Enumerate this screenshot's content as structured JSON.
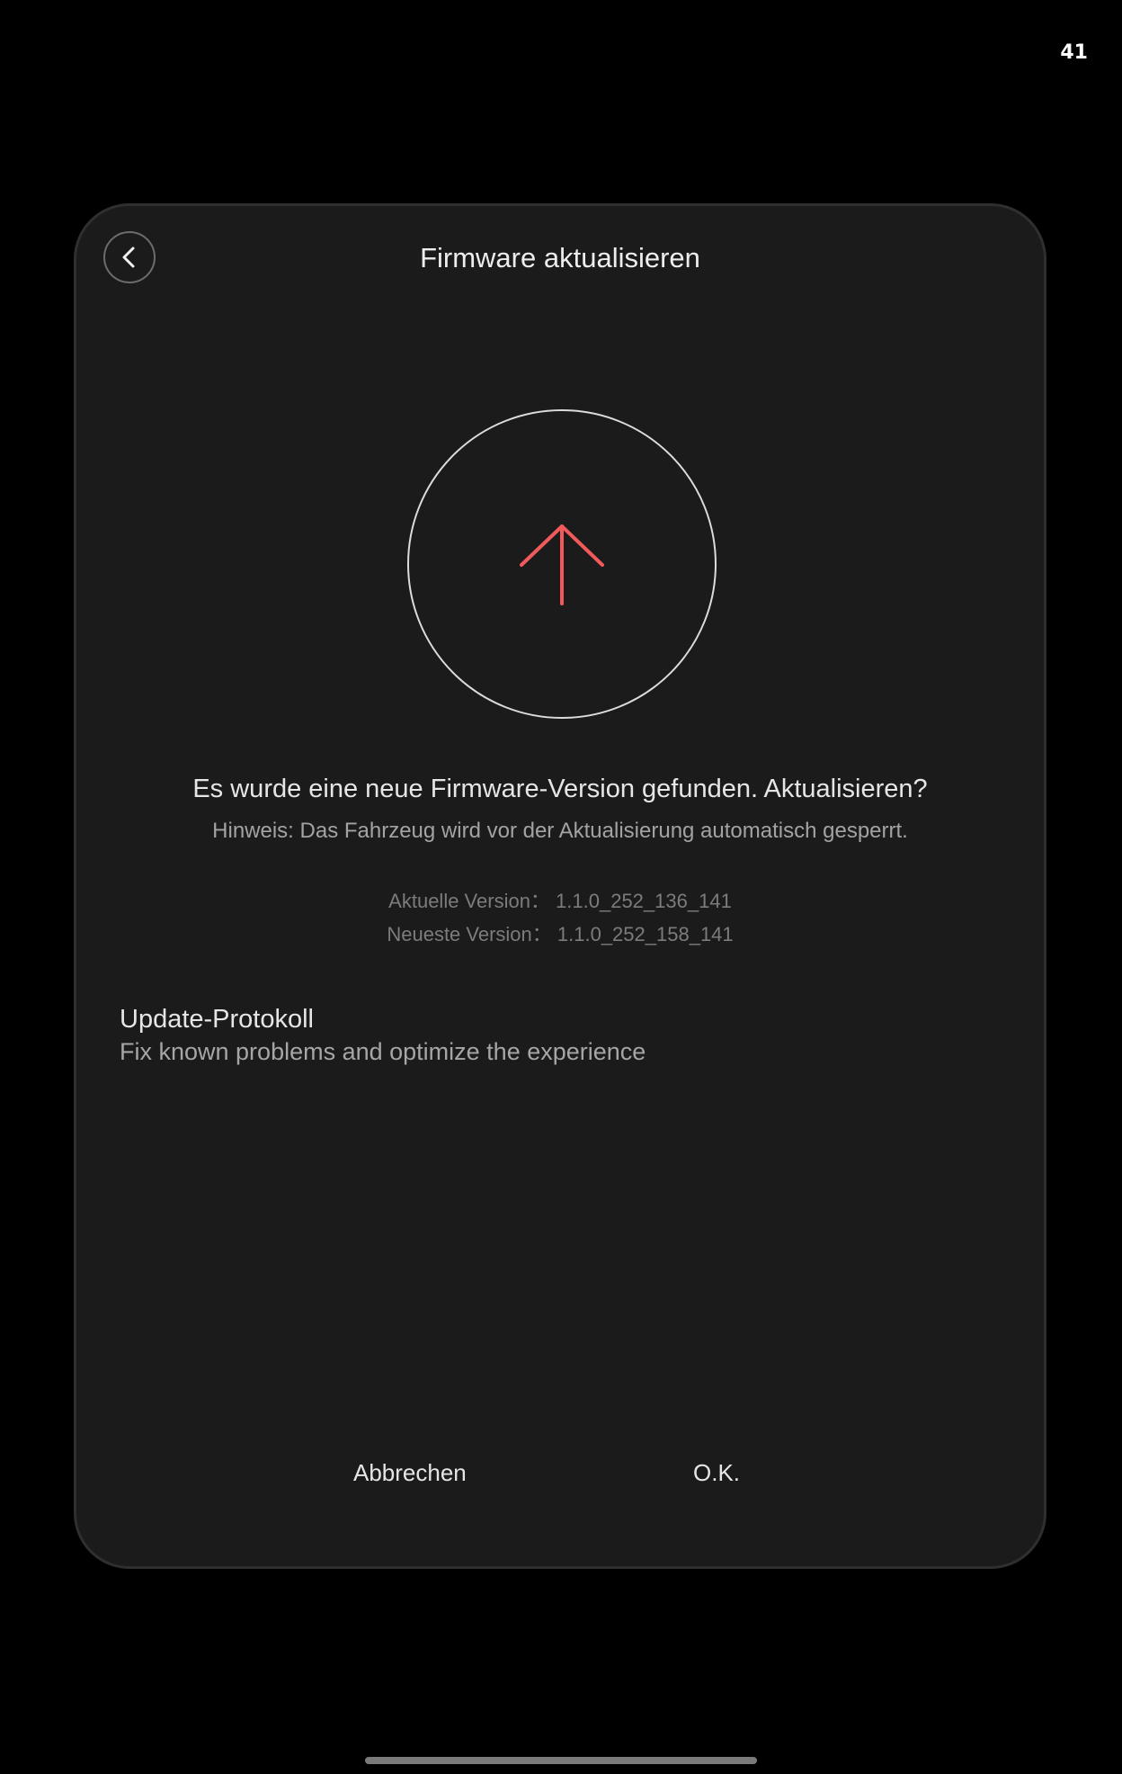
{
  "status": {
    "number": "41"
  },
  "dialog": {
    "title": "Firmware aktualisieren",
    "back_icon": "chevron-left-icon",
    "upload_icon": "arrow-up-icon",
    "accent_color": "#f15a5a",
    "message": "Es wurde eine neue Firmware-Version gefunden. Aktualisieren?",
    "hint": "Hinweis: Das Fahrzeug wird vor der Aktualisierung automatisch gesperrt.",
    "current_version": "Aktuelle Version：  1.1.0_252_136_141",
    "latest_version": "Neueste Version：  1.1.0_252_158_141",
    "changelog": {
      "title": "Update-Protokoll",
      "text": "Fix known problems and optimize the experience"
    },
    "buttons": {
      "cancel": "Abbrechen",
      "ok": "O.K."
    }
  }
}
